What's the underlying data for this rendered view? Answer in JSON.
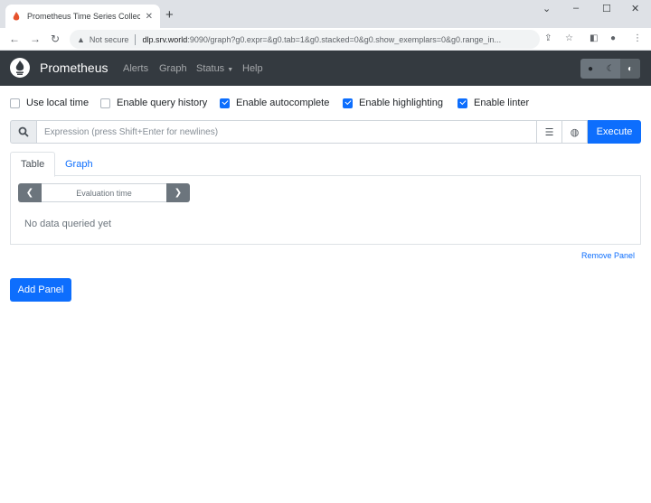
{
  "browser": {
    "tab_title": "Prometheus Time Series Collecti",
    "url_security": "Not secure",
    "url_host": "dlp.srv.world",
    "url_path": ":9090/graph?g0.expr=&g0.tab=1&g0.stacked=0&g0.show_exemplars=0&g0.range_in..."
  },
  "navbar": {
    "brand": "Prometheus",
    "links": [
      "Alerts",
      "Graph",
      "Status",
      "Help"
    ]
  },
  "options": [
    {
      "label": "Use local time",
      "checked": false
    },
    {
      "label": "Enable query history",
      "checked": false
    },
    {
      "label": "Enable autocomplete",
      "checked": true
    },
    {
      "label": "Enable highlighting",
      "checked": true
    },
    {
      "label": "Enable linter",
      "checked": true
    }
  ],
  "expression": {
    "placeholder": "Expression (press Shift+Enter for newlines)",
    "value": "",
    "execute_label": "Execute"
  },
  "panel": {
    "tabs": [
      "Table",
      "Graph"
    ],
    "active_tab": "Table",
    "eval_placeholder": "Evaluation time",
    "empty_message": "No data queried yet",
    "remove_label": "Remove Panel"
  },
  "add_panel_label": "Add Panel",
  "colors": {
    "navbar": "#343a40",
    "primary": "#0d6efd"
  }
}
